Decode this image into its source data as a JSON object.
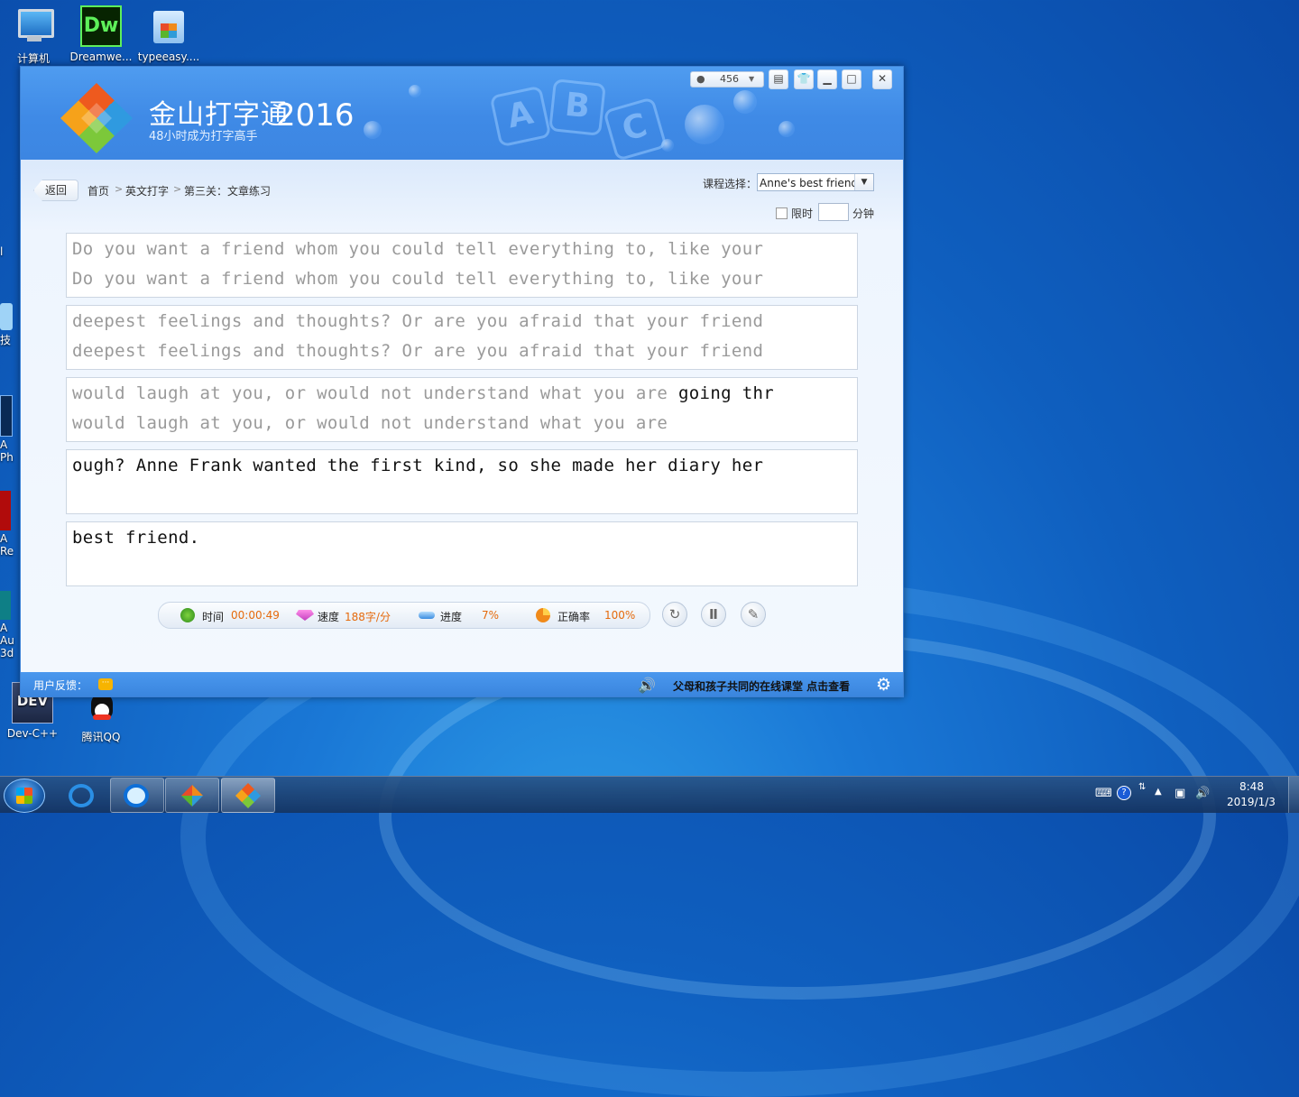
{
  "desktop": {
    "icons": [
      {
        "label": "计算机"
      },
      {
        "label": "Dreamwe...",
        "glyph": "Dw"
      },
      {
        "label": "typeeasy...."
      },
      {
        "label": "Dev-C++",
        "glyph": "DEV"
      },
      {
        "label": "腾讯QQ"
      }
    ],
    "partial_labels": [
      "l",
      "技",
      "A",
      "Ph",
      "A",
      "Re",
      "A",
      "Au",
      "3d"
    ]
  },
  "window": {
    "brand_title": "金山打字通",
    "brand_year": "2016",
    "brand_subtitle": "48小时成为打字高手",
    "banner_letters": [
      "A",
      "B",
      "C"
    ],
    "user_name": "456",
    "controls": {
      "minimize": "▁",
      "maximize": "□",
      "close": "✕"
    }
  },
  "nav": {
    "back_label": "返回",
    "breadcrumb": [
      "首页",
      "英文打字",
      "第三关：文章练习"
    ],
    "separator": ">"
  },
  "course": {
    "label": "课程选择：",
    "selected": "Anne's best friend",
    "limit_label": "限时",
    "limit_value": "",
    "limit_unit": "分钟"
  },
  "lines": [
    {
      "source_done": "Do you want a friend whom you could tell everything to, like your",
      "source_todo": "",
      "typed": "Do you want a friend whom you could tell everything to, like your"
    },
    {
      "source_done": "deepest feelings and thoughts? Or are you afraid that your friend",
      "source_todo": "",
      "typed": "deepest feelings and thoughts? Or are you afraid that your friend"
    },
    {
      "source_done": "would laugh at you, or would not understand what you are ",
      "source_todo": "going thr",
      "typed": "would laugh at you, or would not understand what you are"
    },
    {
      "source_done": "",
      "source_todo": "ough? Anne Frank wanted the first kind, so she made her diary her",
      "typed": ""
    },
    {
      "source_done": "",
      "source_todo": "best friend.",
      "typed": ""
    }
  ],
  "stats": {
    "time_label": "时间",
    "time_value": "00:00:49",
    "speed_label": "速度",
    "speed_value": "188字/分",
    "progress_label": "进度",
    "progress_value": "7%",
    "accuracy_label": "正确率",
    "accuracy_value": "100%"
  },
  "footer": {
    "feedback_label": "用户反馈：",
    "link_text": "父母和孩子共同的在线课堂 点击查看"
  },
  "taskbar": {
    "clock_time": "8:48",
    "clock_date": "2019/1/3"
  },
  "colors": {
    "accent_orange": "#e56a0c",
    "banner_blue": "#3f8ae6",
    "footer_blue": "#3a85de"
  }
}
